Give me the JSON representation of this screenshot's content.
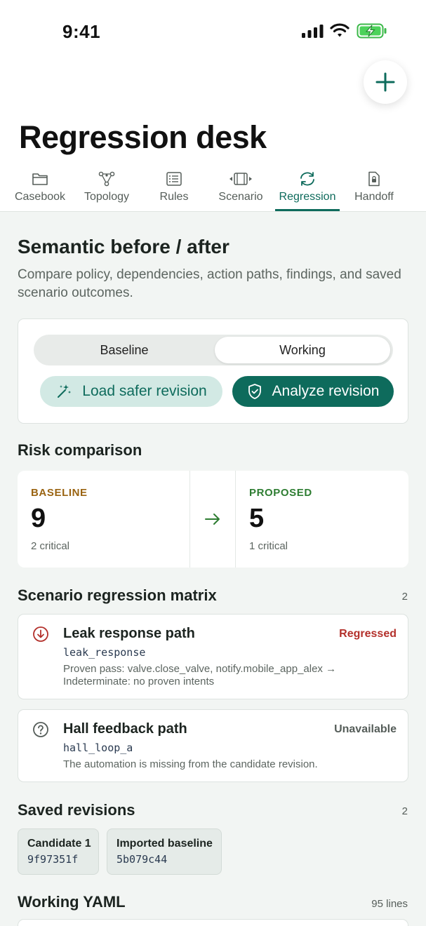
{
  "status_bar": {
    "time": "9:41"
  },
  "header": {
    "title": "Regression desk"
  },
  "tabs": [
    {
      "label": "Casebook",
      "icon": "folder-icon"
    },
    {
      "label": "Topology",
      "icon": "topology-icon"
    },
    {
      "label": "Rules",
      "icon": "list-icon"
    },
    {
      "label": "Scenario",
      "icon": "film-icon"
    },
    {
      "label": "Regression",
      "icon": "refresh-icon",
      "active": true
    },
    {
      "label": "Handoff",
      "icon": "lock-document-icon"
    }
  ],
  "section": {
    "title": "Semantic before / after",
    "description": "Compare policy, dependencies, action paths, findings, and saved scenario outcomes."
  },
  "segmented": {
    "options": [
      "Baseline",
      "Working"
    ],
    "selected": "Working"
  },
  "actions": {
    "load_label": "Load safer revision",
    "analyze_label": "Analyze revision"
  },
  "risk": {
    "title": "Risk comparison",
    "baseline": {
      "label": "BASELINE",
      "value": "9",
      "sub": "2 critical"
    },
    "proposed": {
      "label": "PROPOSED",
      "value": "5",
      "sub": "1 critical"
    }
  },
  "matrix": {
    "title": "Scenario regression matrix",
    "count": "2",
    "items": [
      {
        "title": "Leak response path",
        "code": "leak_response",
        "status": "Regressed",
        "detail_1": "Proven pass: valve.close_valve, notify.mobile_app_alex →",
        "detail_2": "Indeterminate: no proven intents"
      },
      {
        "title": "Hall feedback path",
        "code": "hall_loop_a",
        "status": "Unavailable",
        "detail_1": "The automation is missing from the candidate revision."
      }
    ]
  },
  "revisions": {
    "title": "Saved revisions",
    "count": "2",
    "items": [
      {
        "title": "Candidate 1",
        "hash": "9f97351f"
      },
      {
        "title": "Imported baseline",
        "hash": "5b079c44"
      }
    ]
  },
  "yaml": {
    "title": "Working YAML",
    "lines": "95 lines"
  },
  "colors": {
    "accent": "#0e6b5c",
    "baseline": "#9a6412",
    "proposed": "#2e7d32",
    "regressed": "#b3302b"
  }
}
